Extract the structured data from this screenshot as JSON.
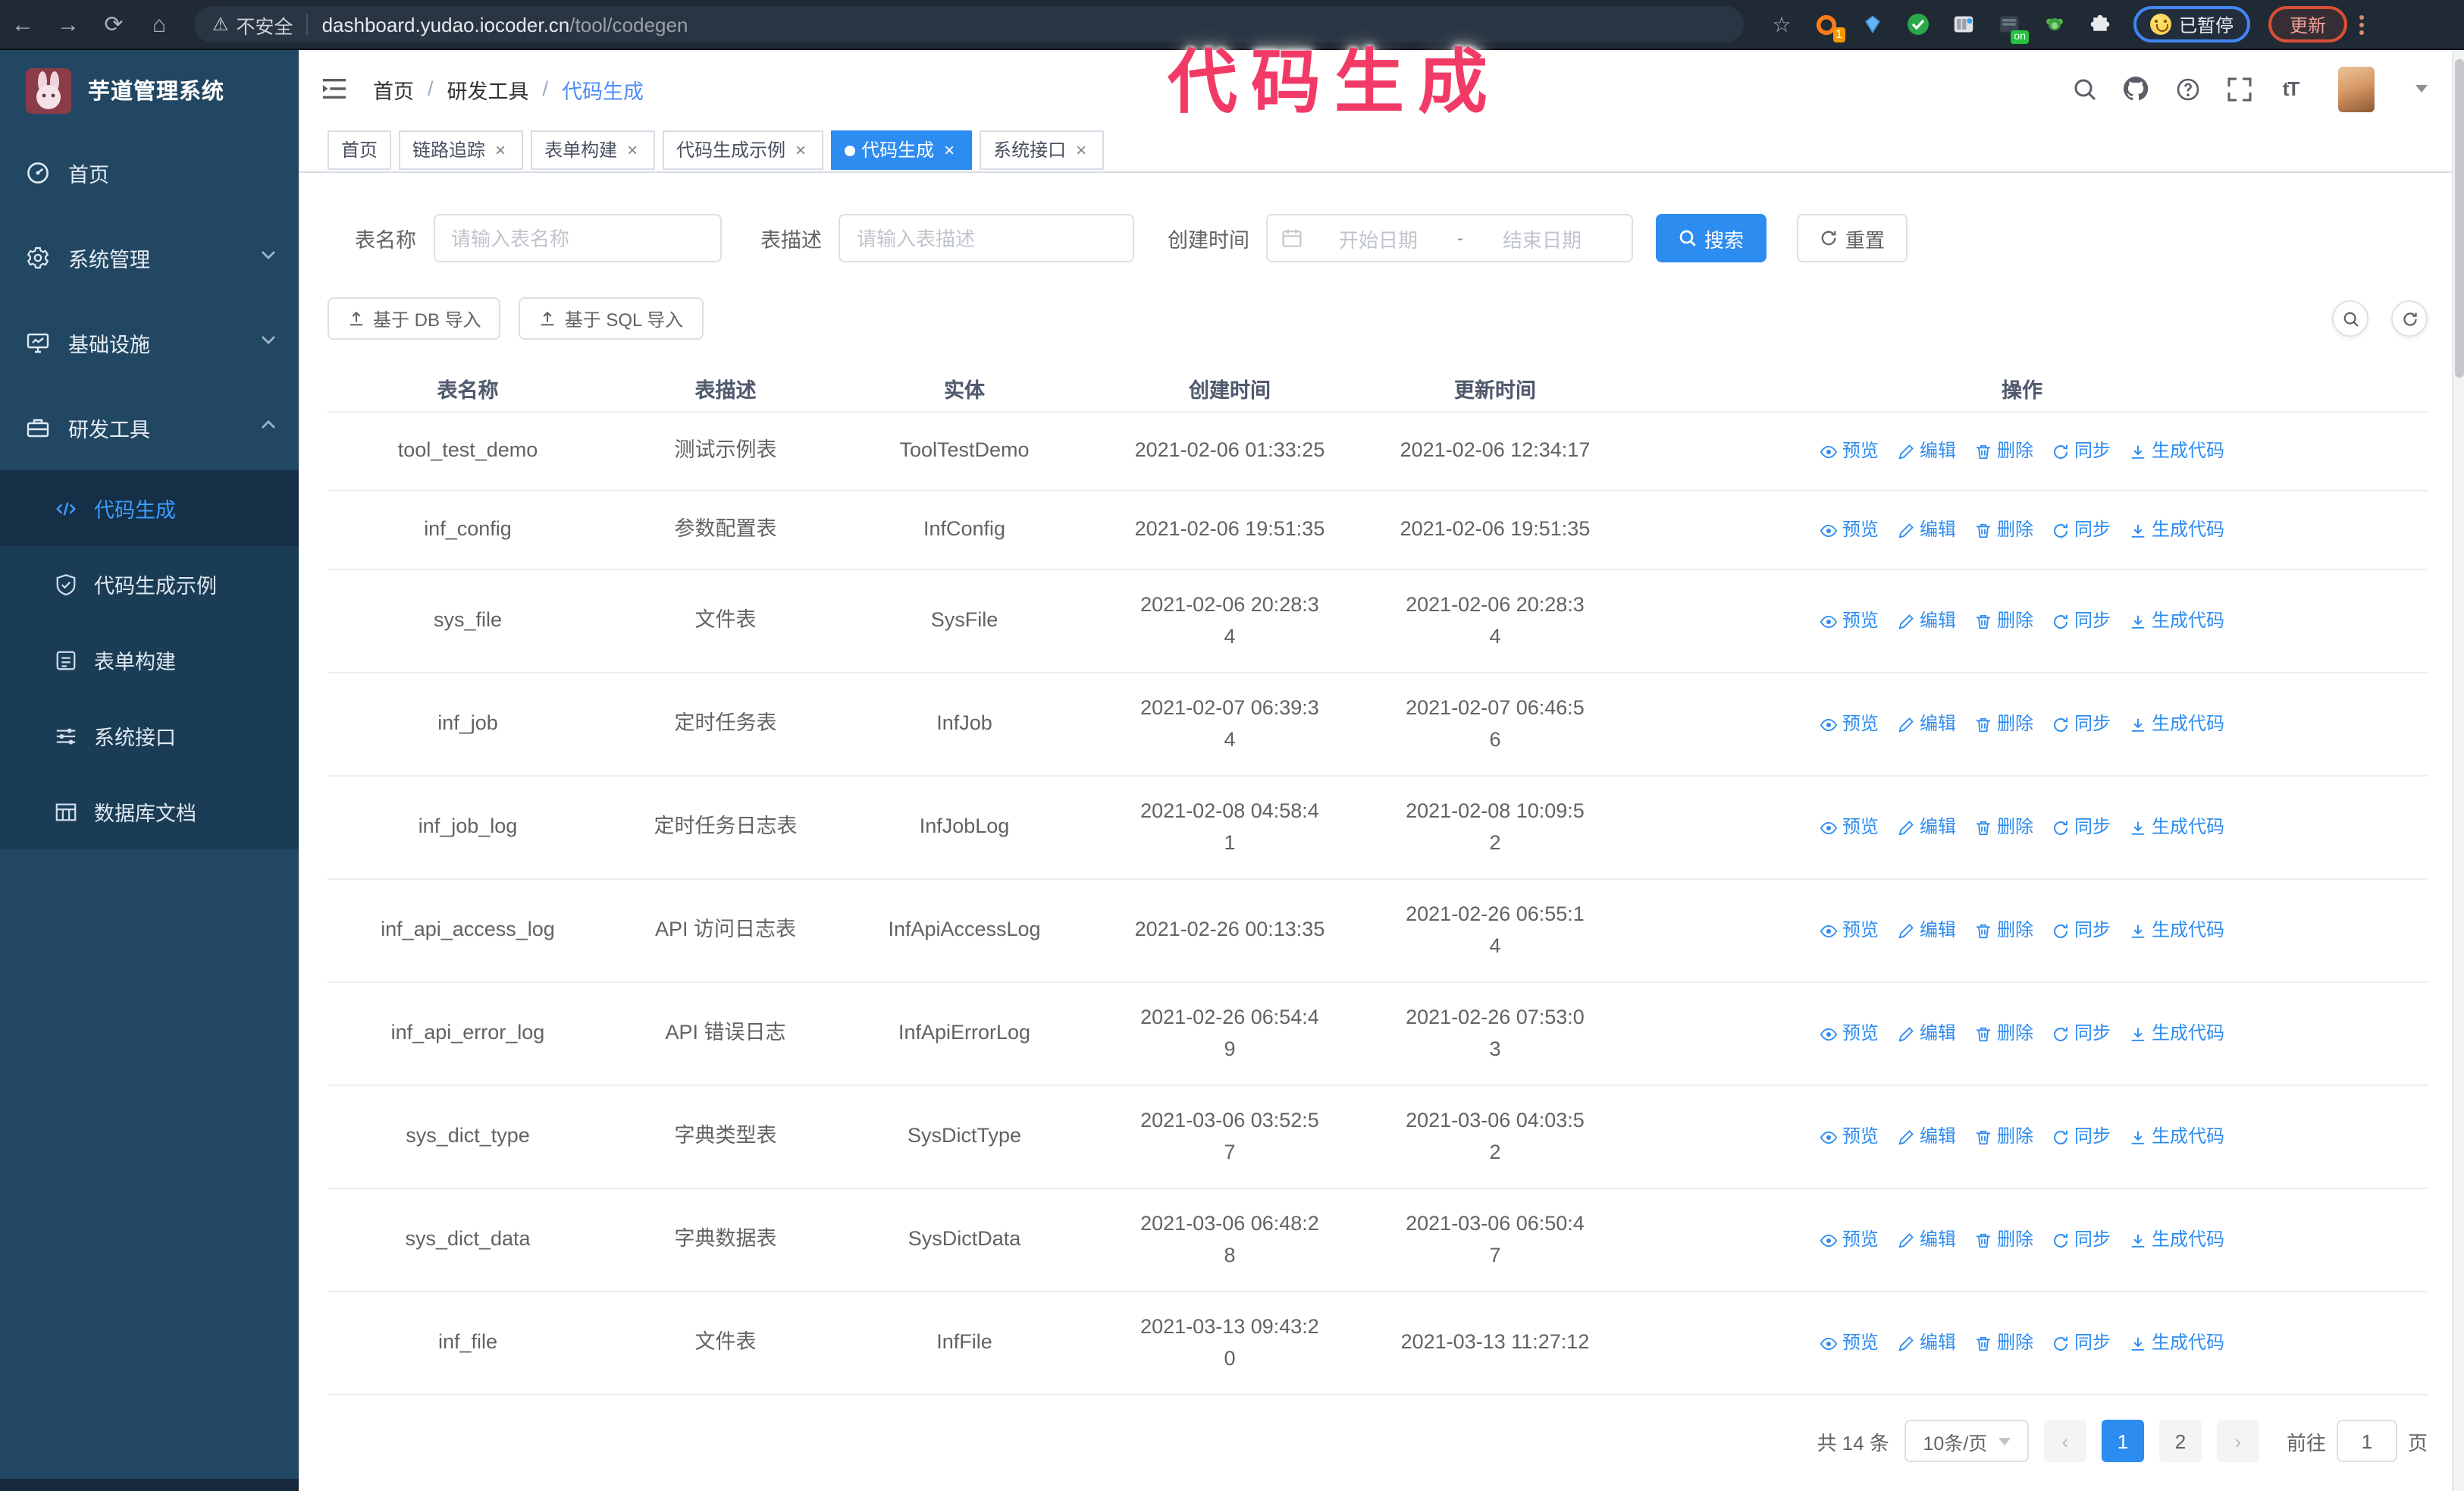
{
  "browser": {
    "security_label": "不安全",
    "url_host": "dashboard.yudao.iocoder.cn",
    "url_path": "/tool/codegen",
    "extension_badge": "1",
    "extension_on_badge": "on",
    "paused_badge": "已暂停",
    "update_button": "更新"
  },
  "overlay": {
    "text": "代码生成",
    "color": "#f23a66"
  },
  "sidebar": {
    "title": "芋道管理系统",
    "items": [
      {
        "label": "首页",
        "icon": "dashboard-icon",
        "expandable": false
      },
      {
        "label": "系统管理",
        "icon": "gear-icon",
        "expandable": true,
        "state": "collapsed"
      },
      {
        "label": "基础设施",
        "icon": "monitor-icon",
        "expandable": true,
        "state": "collapsed"
      },
      {
        "label": "研发工具",
        "icon": "toolbox-icon",
        "expandable": true,
        "state": "expanded"
      }
    ],
    "submenu": [
      {
        "label": "代码生成",
        "icon": "code-icon",
        "active": true
      },
      {
        "label": "代码生成示例",
        "icon": "shield-check-icon",
        "active": false
      },
      {
        "label": "表单构建",
        "icon": "form-icon",
        "active": false
      },
      {
        "label": "系统接口",
        "icon": "sliders-icon",
        "active": false
      },
      {
        "label": "数据库文档",
        "icon": "database-table-icon",
        "active": false
      }
    ]
  },
  "header": {
    "breadcrumb": [
      "首页",
      "研发工具",
      "代码生成"
    ]
  },
  "tabs": [
    {
      "label": "首页",
      "closable": false,
      "active": false
    },
    {
      "label": "链路追踪",
      "closable": true,
      "active": false
    },
    {
      "label": "表单构建",
      "closable": true,
      "active": false
    },
    {
      "label": "代码生成示例",
      "closable": true,
      "active": false
    },
    {
      "label": "代码生成",
      "closable": true,
      "active": true
    },
    {
      "label": "系统接口",
      "closable": true,
      "active": false
    }
  ],
  "filters": {
    "name_label": "表名称",
    "name_placeholder": "请输入表名称",
    "desc_label": "表描述",
    "desc_placeholder": "请输入表描述",
    "time_label": "创建时间",
    "start_placeholder": "开始日期",
    "range_separator": "-",
    "end_placeholder": "结束日期",
    "search_label": "搜索",
    "reset_label": "重置"
  },
  "toolbar": {
    "import_db_label": "基于 DB 导入",
    "import_sql_label": "基于 SQL 导入"
  },
  "table": {
    "columns": [
      "表名称",
      "表描述",
      "实体",
      "创建时间",
      "更新时间",
      "操作"
    ],
    "actions": [
      {
        "label": "预览",
        "icon": "eye-icon",
        "name": "preview-link"
      },
      {
        "label": "编辑",
        "icon": "edit-icon",
        "name": "edit-link"
      },
      {
        "label": "删除",
        "icon": "delete-icon",
        "name": "delete-link"
      },
      {
        "label": "同步",
        "icon": "sync-icon",
        "name": "sync-link"
      },
      {
        "label": "生成代码",
        "icon": "download-icon",
        "name": "generate-code-link"
      }
    ],
    "rows": [
      {
        "name": "tool_test_demo",
        "desc": "测试示例表",
        "entity": "ToolTestDemo",
        "created": "2021-02-06 01:33:25",
        "updated": "2021-02-06 12:34:17",
        "created_wrap": false,
        "updated_wrap": false
      },
      {
        "name": "inf_config",
        "desc": "参数配置表",
        "entity": "InfConfig",
        "created": "2021-02-06 19:51:35",
        "updated": "2021-02-06 19:51:35",
        "created_wrap": false,
        "updated_wrap": false
      },
      {
        "name": "sys_file",
        "desc": "文件表",
        "entity": "SysFile",
        "created": "2021-02-06 20:28:34",
        "updated": "2021-02-06 20:28:34",
        "created_wrap": true,
        "updated_wrap": true
      },
      {
        "name": "inf_job",
        "desc": "定时任务表",
        "entity": "InfJob",
        "created": "2021-02-07 06:39:34",
        "updated": "2021-02-07 06:46:56",
        "created_wrap": true,
        "updated_wrap": true
      },
      {
        "name": "inf_job_log",
        "desc": "定时任务日志表",
        "entity": "InfJobLog",
        "created": "2021-02-08 04:58:41",
        "updated": "2021-02-08 10:09:52",
        "created_wrap": true,
        "updated_wrap": true
      },
      {
        "name": "inf_api_access_log",
        "desc": "API 访问日志表",
        "entity": "InfApiAccessLog",
        "created": "2021-02-26 00:13:35",
        "updated": "2021-02-26 06:55:14",
        "created_wrap": false,
        "updated_wrap": true
      },
      {
        "name": "inf_api_error_log",
        "desc": "API 错误日志",
        "entity": "InfApiErrorLog",
        "created": "2021-02-26 06:54:49",
        "updated": "2021-02-26 07:53:03",
        "created_wrap": true,
        "updated_wrap": true
      },
      {
        "name": "sys_dict_type",
        "desc": "字典类型表",
        "entity": "SysDictType",
        "created": "2021-03-06 03:52:57",
        "updated": "2021-03-06 04:03:52",
        "created_wrap": true,
        "updated_wrap": true
      },
      {
        "name": "sys_dict_data",
        "desc": "字典数据表",
        "entity": "SysDictData",
        "created": "2021-03-06 06:48:28",
        "updated": "2021-03-06 06:50:47",
        "created_wrap": true,
        "updated_wrap": true
      },
      {
        "name": "inf_file",
        "desc": "文件表",
        "entity": "InfFile",
        "created": "2021-03-13 09:43:20",
        "updated": "2021-03-13 11:27:12",
        "created_wrap": true,
        "updated_wrap": false
      }
    ]
  },
  "pagination": {
    "total_label": "共 14 条",
    "page_size": "10条/页",
    "pages": [
      "1",
      "2"
    ],
    "active_page": "1",
    "goto_label": "前往",
    "goto_value": "1",
    "page_suffix": "页"
  },
  "theme": {
    "accent_blue": "#2d8cf0",
    "sidebar_bg": "#224762",
    "submenu_bg": "#1b3c55",
    "annotation_pink": "#f23a66",
    "chrome_bg": "#202a35"
  }
}
